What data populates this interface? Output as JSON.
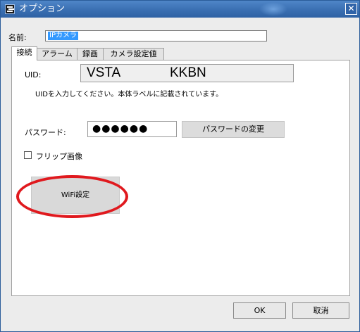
{
  "window": {
    "title": "オプション",
    "close_glyph": "✕",
    "app_icon": "app-icon"
  },
  "name": {
    "label": "名前:",
    "value": "IPカメラ"
  },
  "tabs": [
    {
      "label": "接続",
      "active": true
    },
    {
      "label": "アラーム",
      "active": false
    },
    {
      "label": "録画",
      "active": false
    },
    {
      "label": "カメラ設定値",
      "active": false
    }
  ],
  "connection": {
    "uid_label": "UID:",
    "uid_part1": "VSTA",
    "uid_part2": "KKBN",
    "uid_hint": "UIDを入力してください。本体ラベルに記載されています。",
    "password_label": "パスワード:",
    "password_masked": "●●●●●●",
    "change_password_label": "パスワードの変更",
    "flip_label": "フリップ画像",
    "flip_checked": false,
    "wifi_label": "WiFi設定"
  },
  "footer": {
    "ok_label": "OK",
    "cancel_label": "取消"
  },
  "colors": {
    "title_bar": "#3a6fb2",
    "highlight_ellipse": "#e0191e",
    "selection": "#3399ff"
  }
}
